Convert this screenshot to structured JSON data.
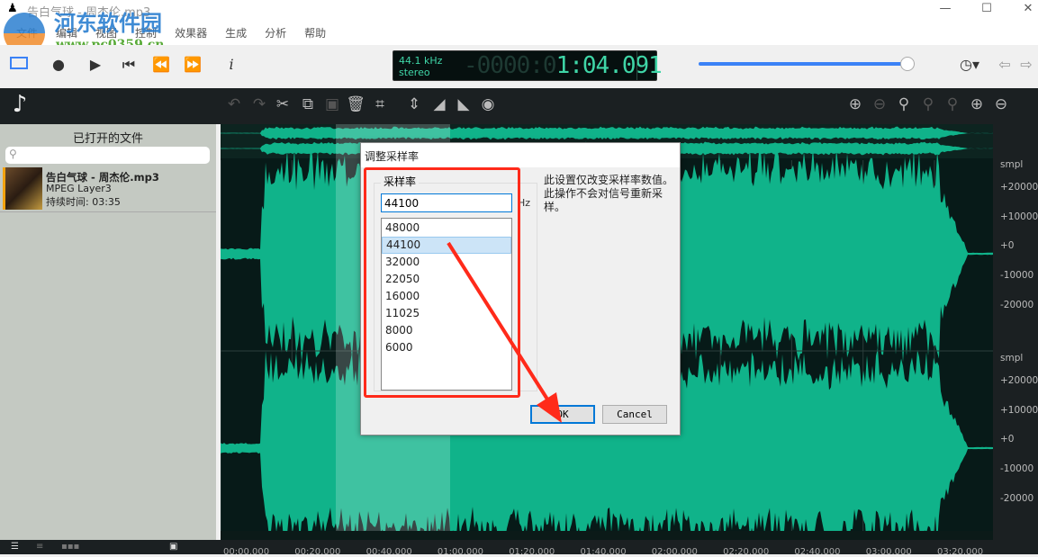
{
  "window": {
    "title": "告白气球 - 周杰伦.mp3",
    "minimize": "—",
    "maximize": "☐",
    "close": "✕"
  },
  "watermark": {
    "site": "河东软件园",
    "url": "www.pc0359.cn"
  },
  "menu": [
    "文件",
    "编辑",
    "视图",
    "控制",
    "效果器",
    "生成",
    "分析",
    "帮助"
  ],
  "lcd": {
    "rate": "44.1 kHz",
    "channels": "stereo",
    "time_dim": "-0000:0",
    "time": "1:04.091"
  },
  "volume": 0.95,
  "left_panel": {
    "title": "已打开的文件",
    "search_placeholder": "",
    "file": {
      "name": "告白气球 - 周杰伦.mp3",
      "format": "MPEG Layer3",
      "duration": "持续时间: 03:35"
    }
  },
  "scale": {
    "unit": "smpl",
    "labels": [
      "+20000",
      "+10000",
      "+0",
      "-10000",
      "-20000"
    ]
  },
  "time_axis": [
    "00:00.000",
    "00:20.000",
    "00:40.000",
    "01:00.000",
    "01:20.000",
    "01:40.000",
    "02:00.000",
    "02:20.000",
    "02:40.000",
    "03:00.000",
    "03:20.000"
  ],
  "dialog": {
    "title": "调整采样率",
    "group": "采样率",
    "value": "44100",
    "unit": "Hz",
    "options": [
      "48000",
      "44100",
      "32000",
      "22050",
      "16000",
      "11025",
      "8000",
      "6000"
    ],
    "selected": "44100",
    "note": "此设置仅改变采样率数值。此操作不会对信号重新采样。",
    "ok": "OK",
    "cancel": "Cancel"
  },
  "colors": {
    "wave": "#10b38a",
    "accent": "#3b82f6",
    "annotation": "#ff2a1a"
  }
}
